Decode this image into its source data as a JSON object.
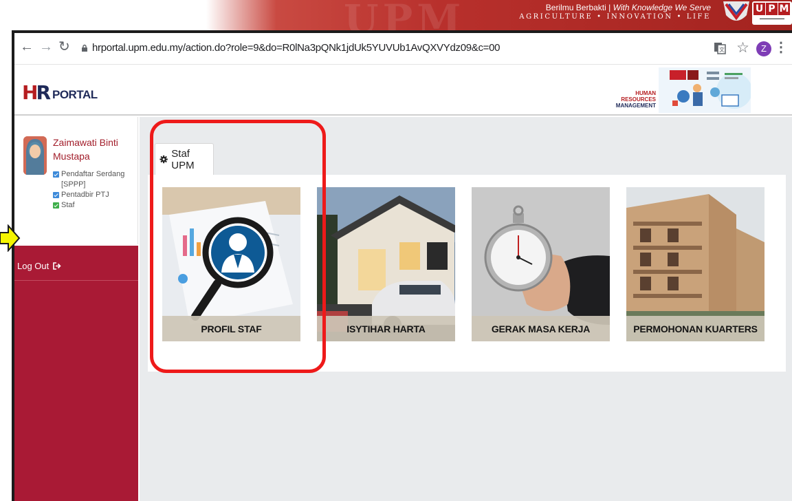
{
  "banner": {
    "tagline_plain": "Berilmu Berbakti | ",
    "tagline_italic": "With Knowledge We Serve",
    "motto": "AGRICULTURE • INNOVATION • LIFE",
    "logo_letters": [
      "U",
      "P",
      "M"
    ]
  },
  "browser": {
    "url": "hrportal.upm.edu.my/action.do?role=9&do=R0lNa3pQNk1jdUk5YUVUb1AvQXVYdz09&c=00",
    "profile_initial": "Z"
  },
  "header": {
    "logo_h": "H",
    "logo_r": "R",
    "logo_text": "PORTAL",
    "hrm_line1": "HUMAN RESOURCES",
    "hrm_line2": "MANAGEMENT"
  },
  "sidebar": {
    "user_name": "Zaimawati Binti Mustapa",
    "roles": [
      {
        "label": "Pendaftar Serdang [SPPP]",
        "color": "#3d8ad9"
      },
      {
        "label": "Pentadbir PTJ",
        "color": "#3d8ad9"
      },
      {
        "label": "Staf",
        "color": "#3eae4a"
      }
    ],
    "logout_label": "Log Out"
  },
  "main": {
    "tab_label": "Staf UPM",
    "cards": [
      {
        "label": "PROFIL STAF",
        "icon": "staff-profile-search-icon"
      },
      {
        "label": "ISYTIHAR HARTA",
        "icon": "house-car-photo"
      },
      {
        "label": "GERAK MASA KERJA",
        "icon": "stopwatch-photo"
      },
      {
        "label": "PERMOHONAN KUARTERS",
        "icon": "apartment-photo"
      }
    ]
  },
  "colors": {
    "brand_red": "#b51d20",
    "sidebar_red": "#a91a35",
    "highlight": "#ee1a1a",
    "arrow_yellow": "#f5f500"
  }
}
